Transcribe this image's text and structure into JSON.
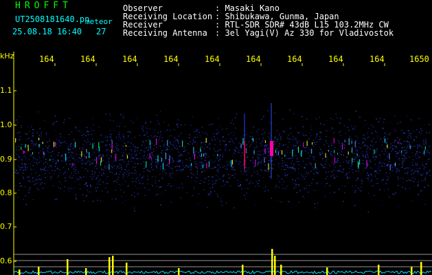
{
  "logo": "HROFFT",
  "file": {
    "name": "UT2508181640.pn",
    "tag": "meteor",
    "datetime": "25.08.18 16:40",
    "count": "27"
  },
  "info": {
    "labels": [
      "Observer",
      "Receiving Location",
      "Receiver",
      "Receiving Antenna"
    ],
    "values": [
      ": Masaki Kano",
      ": Shibukawa, Gunma, Japan",
      ": RTL-SDR SDR# 43dB L15 103.2MHz CW",
      ": 3el Yagi(V) Az 330 for Vladivostok"
    ]
  },
  "xaxis": {
    "ticks": [
      "164",
      "164",
      "164",
      "164",
      "164",
      "164",
      "164",
      "164",
      "164",
      "1650"
    ]
  },
  "yaxis": {
    "unit": "kHz",
    "ticks": [
      "1.1",
      "1.0",
      "0.9",
      "0.8",
      "0.7",
      "0.6"
    ]
  },
  "colors": {
    "background": "#000000",
    "text_white": "#ffffff",
    "text_cyan": "#00ffff",
    "logo_green": "#00ff00",
    "axis_yellow": "#ffff00",
    "noise_blue": "#1a2aa0",
    "meteor_magenta": "#ff00aa"
  }
}
